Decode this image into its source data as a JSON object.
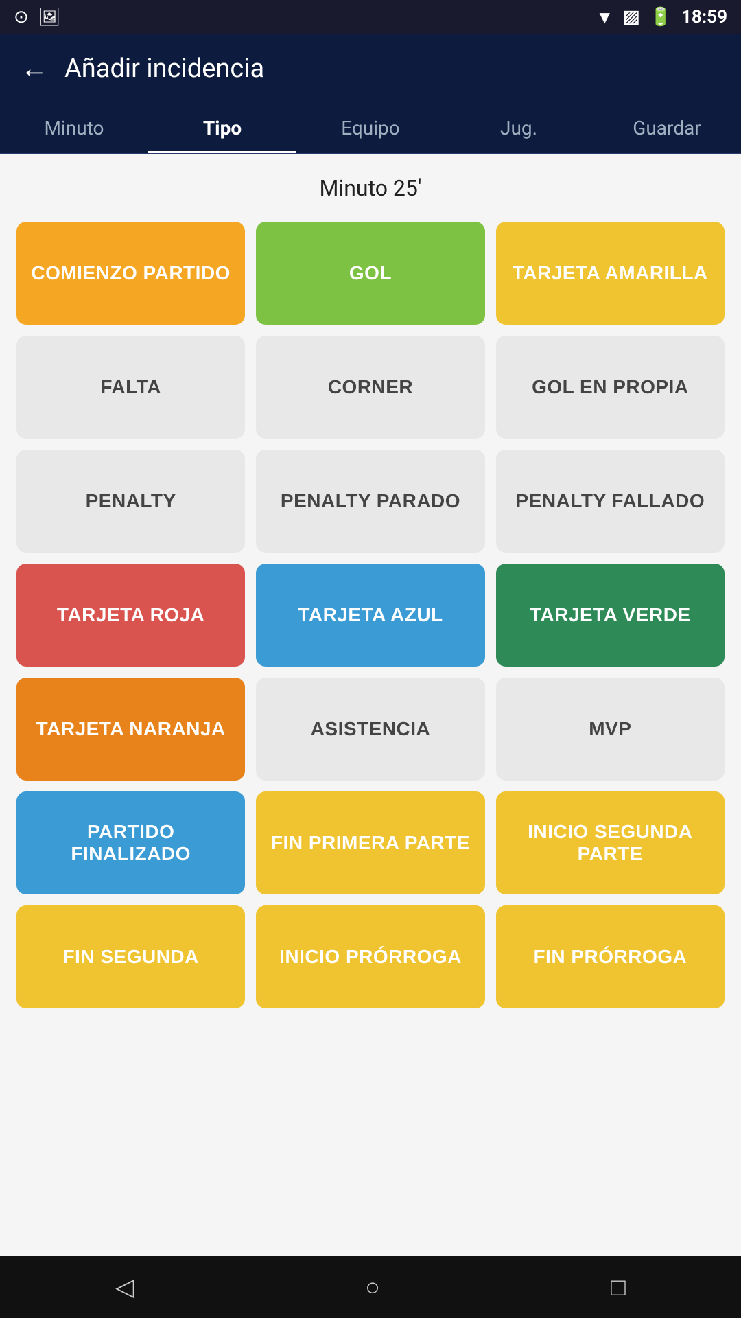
{
  "statusBar": {
    "time": "18:59",
    "icons": [
      "arc-icon",
      "image-icon",
      "wifi-icon",
      "sim-icon",
      "battery-icon"
    ]
  },
  "appBar": {
    "backLabel": "←",
    "title": "Añadir incidencia"
  },
  "tabs": [
    {
      "id": "minuto",
      "label": "Minuto",
      "active": false
    },
    {
      "id": "tipo",
      "label": "Tipo",
      "active": true
    },
    {
      "id": "equipo",
      "label": "Equipo",
      "active": false
    },
    {
      "id": "jug",
      "label": "Jug.",
      "active": false
    },
    {
      "id": "guardar",
      "label": "Guardar",
      "active": false
    }
  ],
  "minuteLabel": "Minuto 25'",
  "tiles": [
    {
      "id": "comienzo-partido",
      "label": "COMIENZO PARTIDO",
      "color": "orange"
    },
    {
      "id": "gol",
      "label": "GOL",
      "color": "green-bright"
    },
    {
      "id": "tarjeta-amarilla",
      "label": "TARJETA AMARILLA",
      "color": "yellow"
    },
    {
      "id": "falta",
      "label": "FALTA",
      "color": "gray"
    },
    {
      "id": "corner",
      "label": "CORNER",
      "color": "gray"
    },
    {
      "id": "gol-en-propia",
      "label": "GOL EN PROPIA",
      "color": "gray"
    },
    {
      "id": "penalty",
      "label": "PENALTY",
      "color": "gray"
    },
    {
      "id": "penalty-parado",
      "label": "PENALTY PARADO",
      "color": "gray"
    },
    {
      "id": "penalty-fallado",
      "label": "PENALTY FALLADO",
      "color": "gray"
    },
    {
      "id": "tarjeta-roja",
      "label": "TARJETA ROJA",
      "color": "red"
    },
    {
      "id": "tarjeta-azul",
      "label": "TARJETA AZUL",
      "color": "blue"
    },
    {
      "id": "tarjeta-verde",
      "label": "TARJETA VERDE",
      "color": "green-dark"
    },
    {
      "id": "tarjeta-naranja",
      "label": "TARJETA NARANJA",
      "color": "orange-dark"
    },
    {
      "id": "asistencia",
      "label": "ASISTENCIA",
      "color": "gray"
    },
    {
      "id": "mvp",
      "label": "MVP",
      "color": "gray"
    },
    {
      "id": "partido-finalizado",
      "label": "PARTIDO FINALIZADO",
      "color": "blue"
    },
    {
      "id": "fin-primera-parte",
      "label": "FIN PRIMERA PARTE",
      "color": "yellow"
    },
    {
      "id": "inicio-segunda-parte",
      "label": "INICIO SEGUNDA PARTE",
      "color": "yellow"
    },
    {
      "id": "fin-segunda",
      "label": "FIN SEGUNDA",
      "color": "yellow"
    },
    {
      "id": "inicio-prorroga",
      "label": "INICIO PRÓRROGA",
      "color": "yellow"
    },
    {
      "id": "fin-prorroga",
      "label": "FIN PRÓRROGA",
      "color": "yellow"
    }
  ],
  "bottomNav": {
    "back": "◁",
    "home": "○",
    "recents": "□"
  }
}
